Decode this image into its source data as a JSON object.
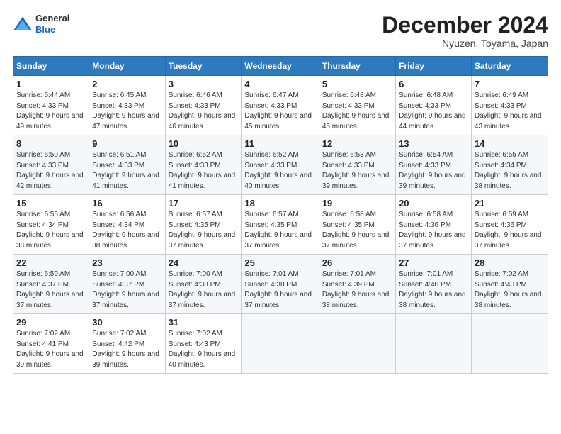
{
  "header": {
    "logo": {
      "general": "General",
      "blue": "Blue"
    },
    "title": "December 2024",
    "location": "Nyuzen, Toyama, Japan"
  },
  "calendar": {
    "days_of_week": [
      "Sunday",
      "Monday",
      "Tuesday",
      "Wednesday",
      "Thursday",
      "Friday",
      "Saturday"
    ],
    "weeks": [
      [
        null,
        null,
        null,
        null,
        null,
        null,
        null
      ]
    ],
    "cells": [
      {
        "day": null
      },
      {
        "day": null
      },
      {
        "day": null
      },
      {
        "day": null
      },
      {
        "day": null
      },
      {
        "day": null
      },
      {
        "day": null
      }
    ],
    "rows": [
      [
        {
          "day": 1,
          "sunrise": "6:44 AM",
          "sunset": "4:33 PM",
          "daylight": "9 hours and 49 minutes."
        },
        {
          "day": 2,
          "sunrise": "6:45 AM",
          "sunset": "4:33 PM",
          "daylight": "9 hours and 47 minutes."
        },
        {
          "day": 3,
          "sunrise": "6:46 AM",
          "sunset": "4:33 PM",
          "daylight": "9 hours and 46 minutes."
        },
        {
          "day": 4,
          "sunrise": "6:47 AM",
          "sunset": "4:33 PM",
          "daylight": "9 hours and 45 minutes."
        },
        {
          "day": 5,
          "sunrise": "6:48 AM",
          "sunset": "4:33 PM",
          "daylight": "9 hours and 45 minutes."
        },
        {
          "day": 6,
          "sunrise": "6:48 AM",
          "sunset": "4:33 PM",
          "daylight": "9 hours and 44 minutes."
        },
        {
          "day": 7,
          "sunrise": "6:49 AM",
          "sunset": "4:33 PM",
          "daylight": "9 hours and 43 minutes."
        }
      ],
      [
        {
          "day": 8,
          "sunrise": "6:50 AM",
          "sunset": "4:33 PM",
          "daylight": "9 hours and 42 minutes."
        },
        {
          "day": 9,
          "sunrise": "6:51 AM",
          "sunset": "4:33 PM",
          "daylight": "9 hours and 41 minutes."
        },
        {
          "day": 10,
          "sunrise": "6:52 AM",
          "sunset": "4:33 PM",
          "daylight": "9 hours and 41 minutes."
        },
        {
          "day": 11,
          "sunrise": "6:52 AM",
          "sunset": "4:33 PM",
          "daylight": "9 hours and 40 minutes."
        },
        {
          "day": 12,
          "sunrise": "6:53 AM",
          "sunset": "4:33 PM",
          "daylight": "9 hours and 39 minutes."
        },
        {
          "day": 13,
          "sunrise": "6:54 AM",
          "sunset": "4:33 PM",
          "daylight": "9 hours and 39 minutes."
        },
        {
          "day": 14,
          "sunrise": "6:55 AM",
          "sunset": "4:34 PM",
          "daylight": "9 hours and 38 minutes."
        }
      ],
      [
        {
          "day": 15,
          "sunrise": "6:55 AM",
          "sunset": "4:34 PM",
          "daylight": "9 hours and 38 minutes."
        },
        {
          "day": 16,
          "sunrise": "6:56 AM",
          "sunset": "4:34 PM",
          "daylight": "9 hours and 38 minutes."
        },
        {
          "day": 17,
          "sunrise": "6:57 AM",
          "sunset": "4:35 PM",
          "daylight": "9 hours and 37 minutes."
        },
        {
          "day": 18,
          "sunrise": "6:57 AM",
          "sunset": "4:35 PM",
          "daylight": "9 hours and 37 minutes."
        },
        {
          "day": 19,
          "sunrise": "6:58 AM",
          "sunset": "4:35 PM",
          "daylight": "9 hours and 37 minutes."
        },
        {
          "day": 20,
          "sunrise": "6:58 AM",
          "sunset": "4:36 PM",
          "daylight": "9 hours and 37 minutes."
        },
        {
          "day": 21,
          "sunrise": "6:59 AM",
          "sunset": "4:36 PM",
          "daylight": "9 hours and 37 minutes."
        }
      ],
      [
        {
          "day": 22,
          "sunrise": "6:59 AM",
          "sunset": "4:37 PM",
          "daylight": "9 hours and 37 minutes."
        },
        {
          "day": 23,
          "sunrise": "7:00 AM",
          "sunset": "4:37 PM",
          "daylight": "9 hours and 37 minutes."
        },
        {
          "day": 24,
          "sunrise": "7:00 AM",
          "sunset": "4:38 PM",
          "daylight": "9 hours and 37 minutes."
        },
        {
          "day": 25,
          "sunrise": "7:01 AM",
          "sunset": "4:38 PM",
          "daylight": "9 hours and 37 minutes."
        },
        {
          "day": 26,
          "sunrise": "7:01 AM",
          "sunset": "4:39 PM",
          "daylight": "9 hours and 38 minutes."
        },
        {
          "day": 27,
          "sunrise": "7:01 AM",
          "sunset": "4:40 PM",
          "daylight": "9 hours and 38 minutes."
        },
        {
          "day": 28,
          "sunrise": "7:02 AM",
          "sunset": "4:40 PM",
          "daylight": "9 hours and 38 minutes."
        }
      ],
      [
        {
          "day": 29,
          "sunrise": "7:02 AM",
          "sunset": "4:41 PM",
          "daylight": "9 hours and 39 minutes."
        },
        {
          "day": 30,
          "sunrise": "7:02 AM",
          "sunset": "4:42 PM",
          "daylight": "9 hours and 39 minutes."
        },
        {
          "day": 31,
          "sunrise": "7:02 AM",
          "sunset": "4:43 PM",
          "daylight": "9 hours and 40 minutes."
        },
        null,
        null,
        null,
        null
      ]
    ]
  }
}
